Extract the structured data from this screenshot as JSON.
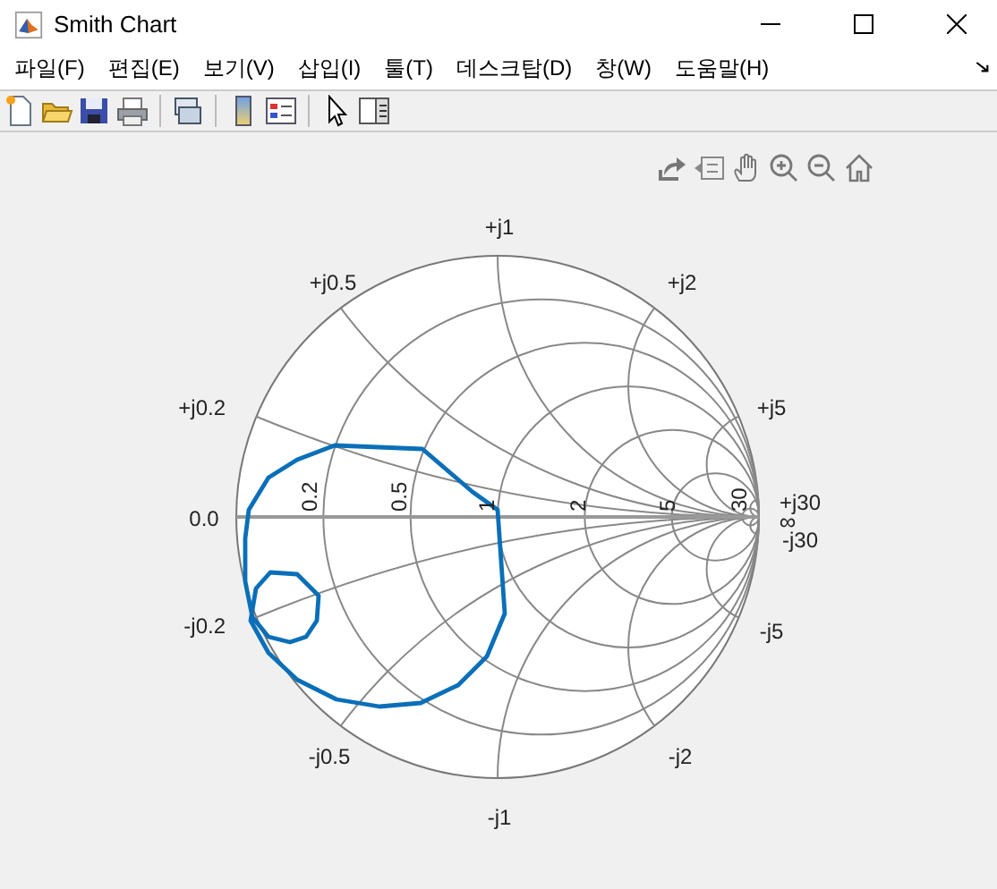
{
  "window": {
    "title": "Smith Chart"
  },
  "menu": [
    {
      "label": "파일(F)"
    },
    {
      "label": "편집(E)"
    },
    {
      "label": "보기(V)"
    },
    {
      "label": "삽입(I)"
    },
    {
      "label": "툴(T)"
    },
    {
      "label": "데스크탑(D)"
    },
    {
      "label": "창(W)"
    },
    {
      "label": "도움말(H)"
    }
  ],
  "chart": {
    "reactance_labels": [
      "+j1",
      "+j0.5",
      "+j2",
      "+j0.2",
      "+j5",
      "+j30",
      "-j30",
      "-j0.2",
      "-j5",
      "-j0.5",
      "-j2",
      "-j1"
    ],
    "zero_label": "0.0",
    "infinity_label": "∞",
    "resistance_labels": [
      "0.2",
      "0.5",
      "1",
      "2",
      "5",
      "30"
    ]
  }
}
